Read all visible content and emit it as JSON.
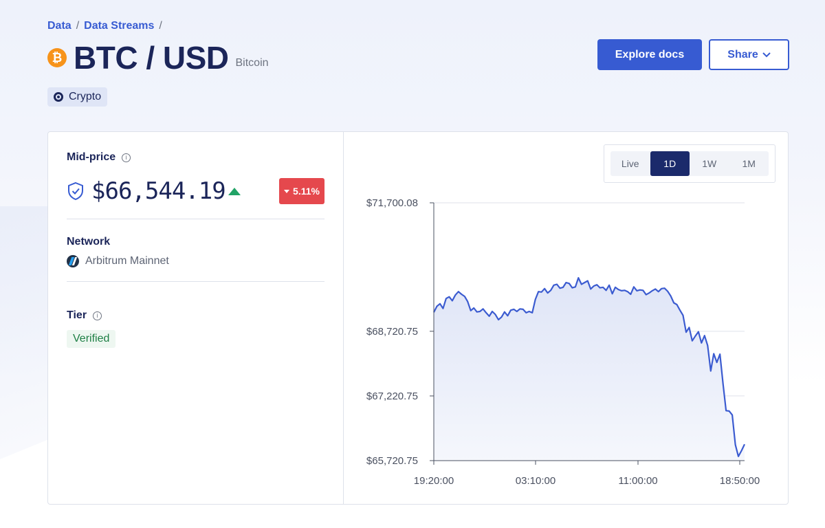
{
  "breadcrumb": {
    "item1": "Data",
    "item2": "Data Streams",
    "sep": "/"
  },
  "header": {
    "icon_glyph": "₿",
    "title": "BTC / USD",
    "subtitle": "Bitcoin",
    "explore_label": "Explore docs",
    "share_label": "Share"
  },
  "tag": {
    "label": "Crypto",
    "icon": "crypto-icon"
  },
  "panel": {
    "midprice_label": "Mid-price",
    "price": "$66,544.19",
    "change": "5.11%",
    "network_label": "Network",
    "network_value": "Arbitrum Mainnet",
    "tier_label": "Tier",
    "tier_value": "Verified"
  },
  "range": {
    "options": [
      "Live",
      "1D",
      "1W",
      "1M"
    ],
    "selected": "1D"
  },
  "colors": {
    "accent": "#375bd2",
    "up": "#21a366",
    "down": "#e5484d",
    "line": "#3b5bd0"
  },
  "chart_data": {
    "type": "area",
    "ylim": [
      65720.75,
      71700.08
    ],
    "yticks": [
      71700.08,
      68720.75,
      67220.75,
      65720.75
    ],
    "ytick_labels": [
      "$71,700.08",
      "$68,720.75",
      "$67,220.75",
      "$65,720.75"
    ],
    "xticks": [
      "19:20:00",
      "03:10:00",
      "11:00:00",
      "18:50:00"
    ],
    "grid": true,
    "values": [
      69160,
      69300,
      69360,
      69250,
      69480,
      69520,
      69430,
      69560,
      69640,
      69580,
      69530,
      69410,
      69200,
      69260,
      69170,
      69180,
      69240,
      69150,
      69070,
      69180,
      69110,
      68990,
      69050,
      69170,
      69080,
      69210,
      69230,
      69180,
      69240,
      69230,
      69150,
      69180,
      69150,
      69460,
      69640,
      69630,
      69710,
      69610,
      69670,
      69790,
      69810,
      69720,
      69740,
      69850,
      69830,
      69730,
      69750,
      69960,
      69810,
      69850,
      69890,
      69700,
      69770,
      69800,
      69730,
      69740,
      69670,
      69790,
      69590,
      69740,
      69690,
      69660,
      69670,
      69640,
      69580,
      69750,
      69660,
      69680,
      69670,
      69570,
      69610,
      69660,
      69700,
      69640,
      69710,
      69720,
      69650,
      69540,
      69380,
      69340,
      69210,
      69090,
      68700,
      68810,
      68500,
      68610,
      68710,
      68450,
      68620,
      68390,
      67800,
      68200,
      68000,
      68190,
      67500,
      66880,
      66870,
      66780,
      66090,
      65820,
      65950,
      66100
    ]
  }
}
